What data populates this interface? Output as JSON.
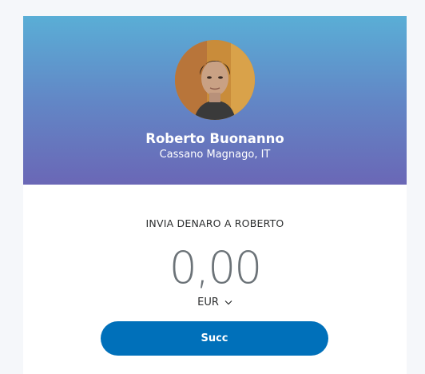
{
  "recipient": {
    "name": "Roberto Buonanno",
    "location": "Cassano Magnago, IT",
    "avatar_icon": "profile-photo"
  },
  "send": {
    "label": "INVIA DENARO A ROBERTO",
    "amount": "0,00",
    "currency": "EUR",
    "currency_icon": "chevron-down-icon",
    "next_button_label": "Succ"
  },
  "colors": {
    "header_gradient_top": "#5aaed6",
    "header_gradient_bottom": "#6a67b6",
    "button_primary": "#0070ba",
    "amount_text": "#6c7378",
    "page_background": "#f5f7fa"
  }
}
